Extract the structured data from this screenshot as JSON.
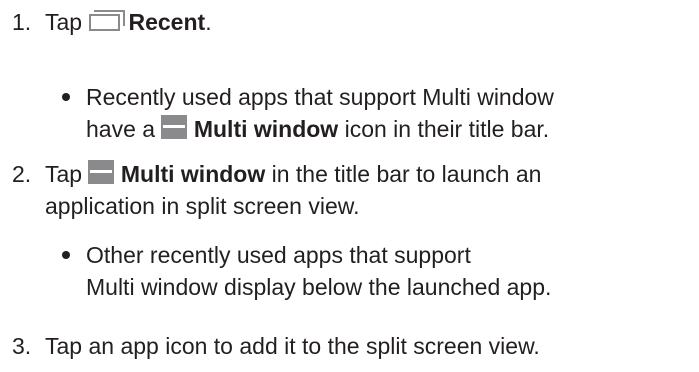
{
  "step1": {
    "number": "1.",
    "text_before": "Tap",
    "bold": "Recent",
    "text_after": ".",
    "icon": "recent-apps-icon"
  },
  "bullet1": {
    "line1": "Recently used apps that support Multi window",
    "line2_before": "have a",
    "bold": "Multi window",
    "line2_after": "icon in their title bar.",
    "icon": "multi-window-icon"
  },
  "step2": {
    "number": "2.",
    "text_before": "Tap",
    "bold": "Multi window",
    "line1_after": "in the title bar to launch an",
    "line2": "application in split screen view.",
    "icon": "multi-window-icon"
  },
  "bullet2": {
    "line1": "Other recently used apps that support",
    "line2": "Multi window display below the launched app."
  },
  "step3": {
    "number": "3.",
    "text": "Tap an app icon to add it to the split screen view."
  }
}
